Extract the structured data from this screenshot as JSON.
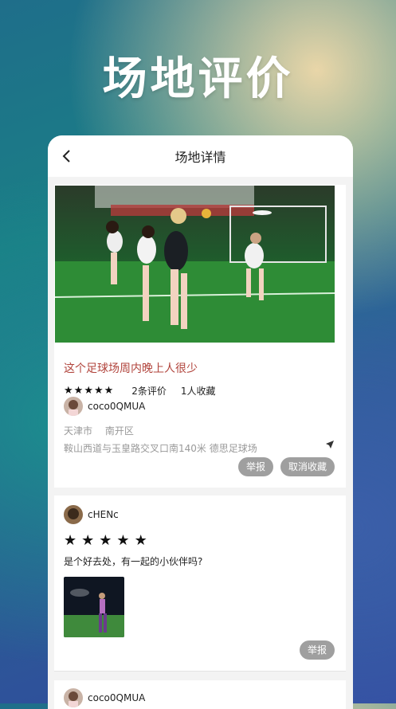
{
  "hero": {
    "title": "场地评价"
  },
  "nav": {
    "title": "场地详情"
  },
  "venue": {
    "title": "这个足球场周内晚上人很少",
    "rating": 5,
    "review_count": "2条评价",
    "favorites": "1人收藏",
    "owner": "coco0QMUA",
    "city": "天津市",
    "district": "南开区",
    "address": "鞍山西道与玉皇路交叉口南140米 德思足球场",
    "report_label": "举报",
    "unfavorite_label": "取消收藏"
  },
  "comments": [
    {
      "user": "cHENc",
      "rating": 5,
      "text": "是个好去处，有一起的小伙伴吗?",
      "report_label": "举报"
    },
    {
      "user": "coco0QMUA"
    }
  ],
  "colors": {
    "title_red": "#b1443c",
    "pill_gray": "#9f9f9f"
  },
  "icons": {
    "back": "chevron-left-icon",
    "location": "navigation-arrow-icon",
    "star": "star-icon"
  }
}
